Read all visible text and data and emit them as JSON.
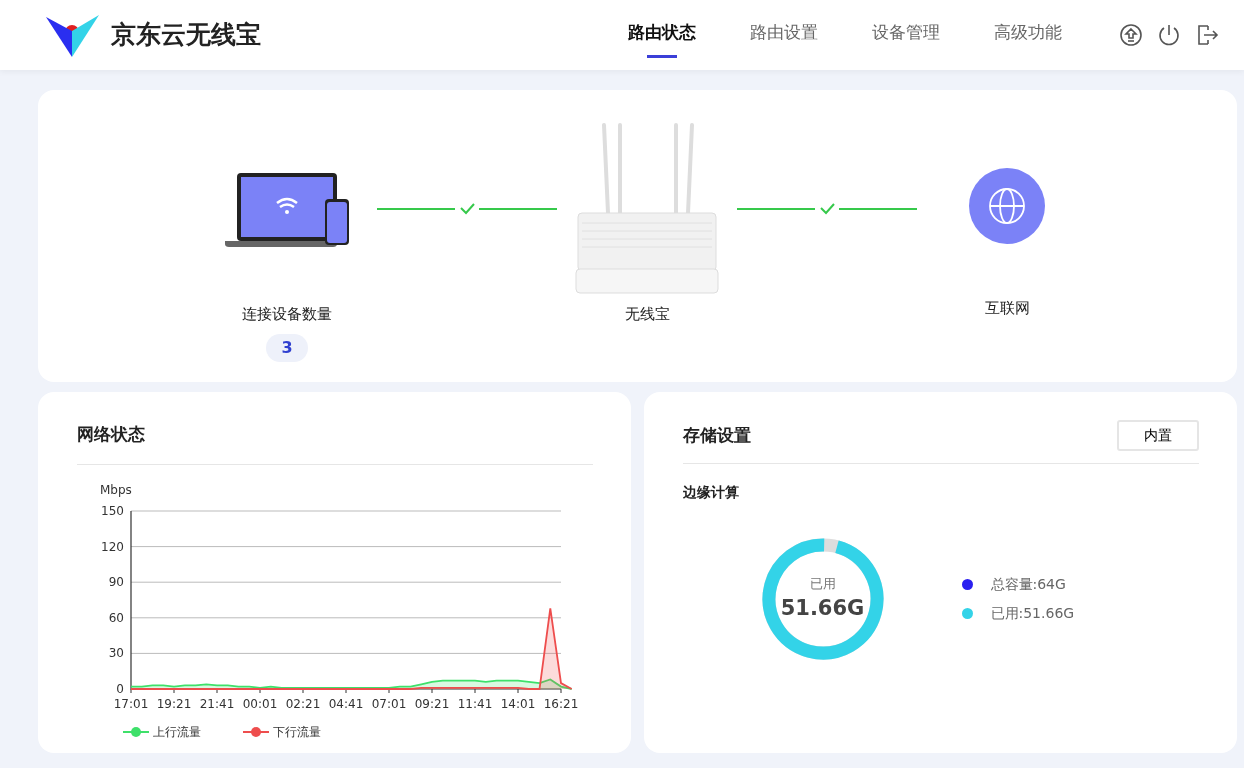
{
  "header": {
    "brand": "京东云无线宝",
    "tabs": [
      {
        "label": "路由状态",
        "selected": true
      },
      {
        "label": "路由设置",
        "selected": false
      },
      {
        "label": "设备管理",
        "selected": false
      },
      {
        "label": "高级功能",
        "selected": false
      }
    ]
  },
  "topology": {
    "devices": {
      "label": "连接设备数量",
      "count": "3"
    },
    "router": {
      "label": "无线宝"
    },
    "internet": {
      "label": "互联网"
    },
    "links": [
      {
        "connected": true
      },
      {
        "connected": true
      }
    ]
  },
  "network_status": {
    "title": "网络状态",
    "chart_data": {
      "type": "area",
      "ylabel": "Mbps",
      "categories": [
        "17:01",
        null,
        null,
        null,
        "19:21",
        null,
        null,
        null,
        "21:41",
        null,
        null,
        null,
        "00:01",
        null,
        null,
        null,
        "02:21",
        null,
        null,
        null,
        "04:41",
        null,
        null,
        null,
        "07:01",
        null,
        null,
        null,
        "09:21",
        null,
        null,
        null,
        "11:41",
        null,
        null,
        null,
        "14:01",
        null,
        null,
        null,
        "16:21",
        null
      ],
      "series": [
        {
          "name": "上行流量",
          "color": "#3ee06a",
          "values": [
            2,
            2,
            3,
            3,
            2,
            3,
            3,
            4,
            3,
            3,
            2,
            2,
            1,
            2,
            1,
            1,
            1,
            1,
            1,
            1,
            1,
            1,
            1,
            1,
            1,
            2,
            2,
            4,
            6,
            7,
            7,
            7,
            7,
            6,
            7,
            7,
            7,
            6,
            5,
            8,
            2,
            0
          ]
        },
        {
          "name": "下行流量",
          "color": "#ee4d4d",
          "values": [
            0,
            0,
            0,
            0,
            0,
            0,
            0,
            0,
            0,
            0,
            0,
            0,
            0,
            0,
            0,
            0,
            0,
            0,
            0,
            0,
            0,
            0,
            0,
            0,
            0,
            0,
            0,
            1,
            1,
            1,
            1,
            1,
            1,
            1,
            1,
            1,
            1,
            0,
            0,
            68,
            5,
            0
          ]
        }
      ],
      "ylim": [
        0,
        150
      ],
      "yticks": [
        0,
        30,
        60,
        90,
        120,
        150
      ],
      "grid": "y",
      "legend": "bottom"
    }
  },
  "storage": {
    "title": "存储设置",
    "button": "内置",
    "section": "边缘计算",
    "ring": {
      "caption": "已用",
      "value": "51.66G",
      "level": 0.96
    },
    "legend": [
      {
        "label": "总容量:64G",
        "color": "#2a1ff0"
      },
      {
        "label": "已用:51.66G",
        "color": "#33d3e8"
      }
    ]
  }
}
